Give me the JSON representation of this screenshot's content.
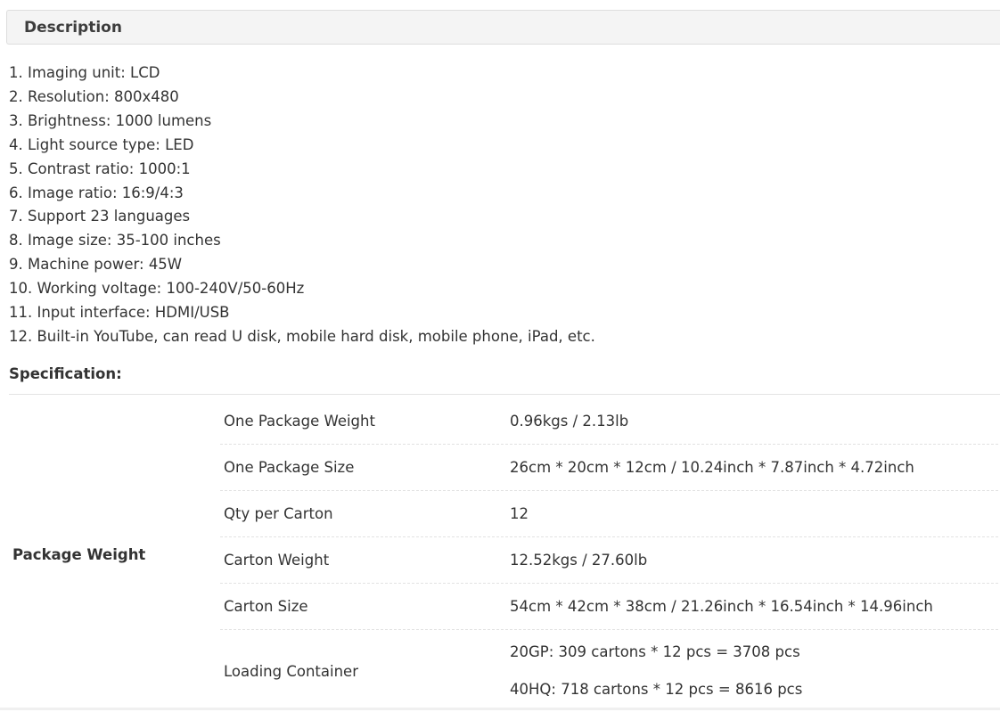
{
  "description": {
    "title": "Description",
    "items": [
      "1. Imaging unit: LCD",
      "2. Resolution: 800x480",
      "3. Brightness: 1000 lumens",
      "4. Light source type: LED",
      "5. Contrast ratio: 1000:1",
      "6. Image ratio: 16:9/4:3",
      "7. Support 23 languages",
      "8. Image size: 35-100 inches",
      "9. Machine power: 45W",
      "10. Working voltage: 100-240V/50-60Hz",
      "11. Input interface: HDMI/USB",
      "12. Built-in YouTube, can read U disk, mobile hard disk, mobile phone, iPad, etc."
    ]
  },
  "specification": {
    "heading": "Specification:",
    "group_label": "Package Weight",
    "rows": [
      {
        "key": "One Package Weight",
        "value": "0.96kgs / 2.13lb"
      },
      {
        "key": "One Package Size",
        "value": "26cm * 20cm * 12cm / 10.24inch * 7.87inch * 4.72inch"
      },
      {
        "key": "Qty per Carton",
        "value": "12"
      },
      {
        "key": "Carton Weight",
        "value": "12.52kgs / 27.60lb"
      },
      {
        "key": "Carton Size",
        "value": "54cm * 42cm * 38cm / 21.26inch * 16.54inch * 14.96inch"
      }
    ],
    "loading": {
      "key": "Loading Container",
      "values": [
        "20GP: 309 cartons * 12 pcs = 3708 pcs",
        "40HQ: 718 cartons * 12 pcs = 8616 pcs"
      ]
    }
  }
}
